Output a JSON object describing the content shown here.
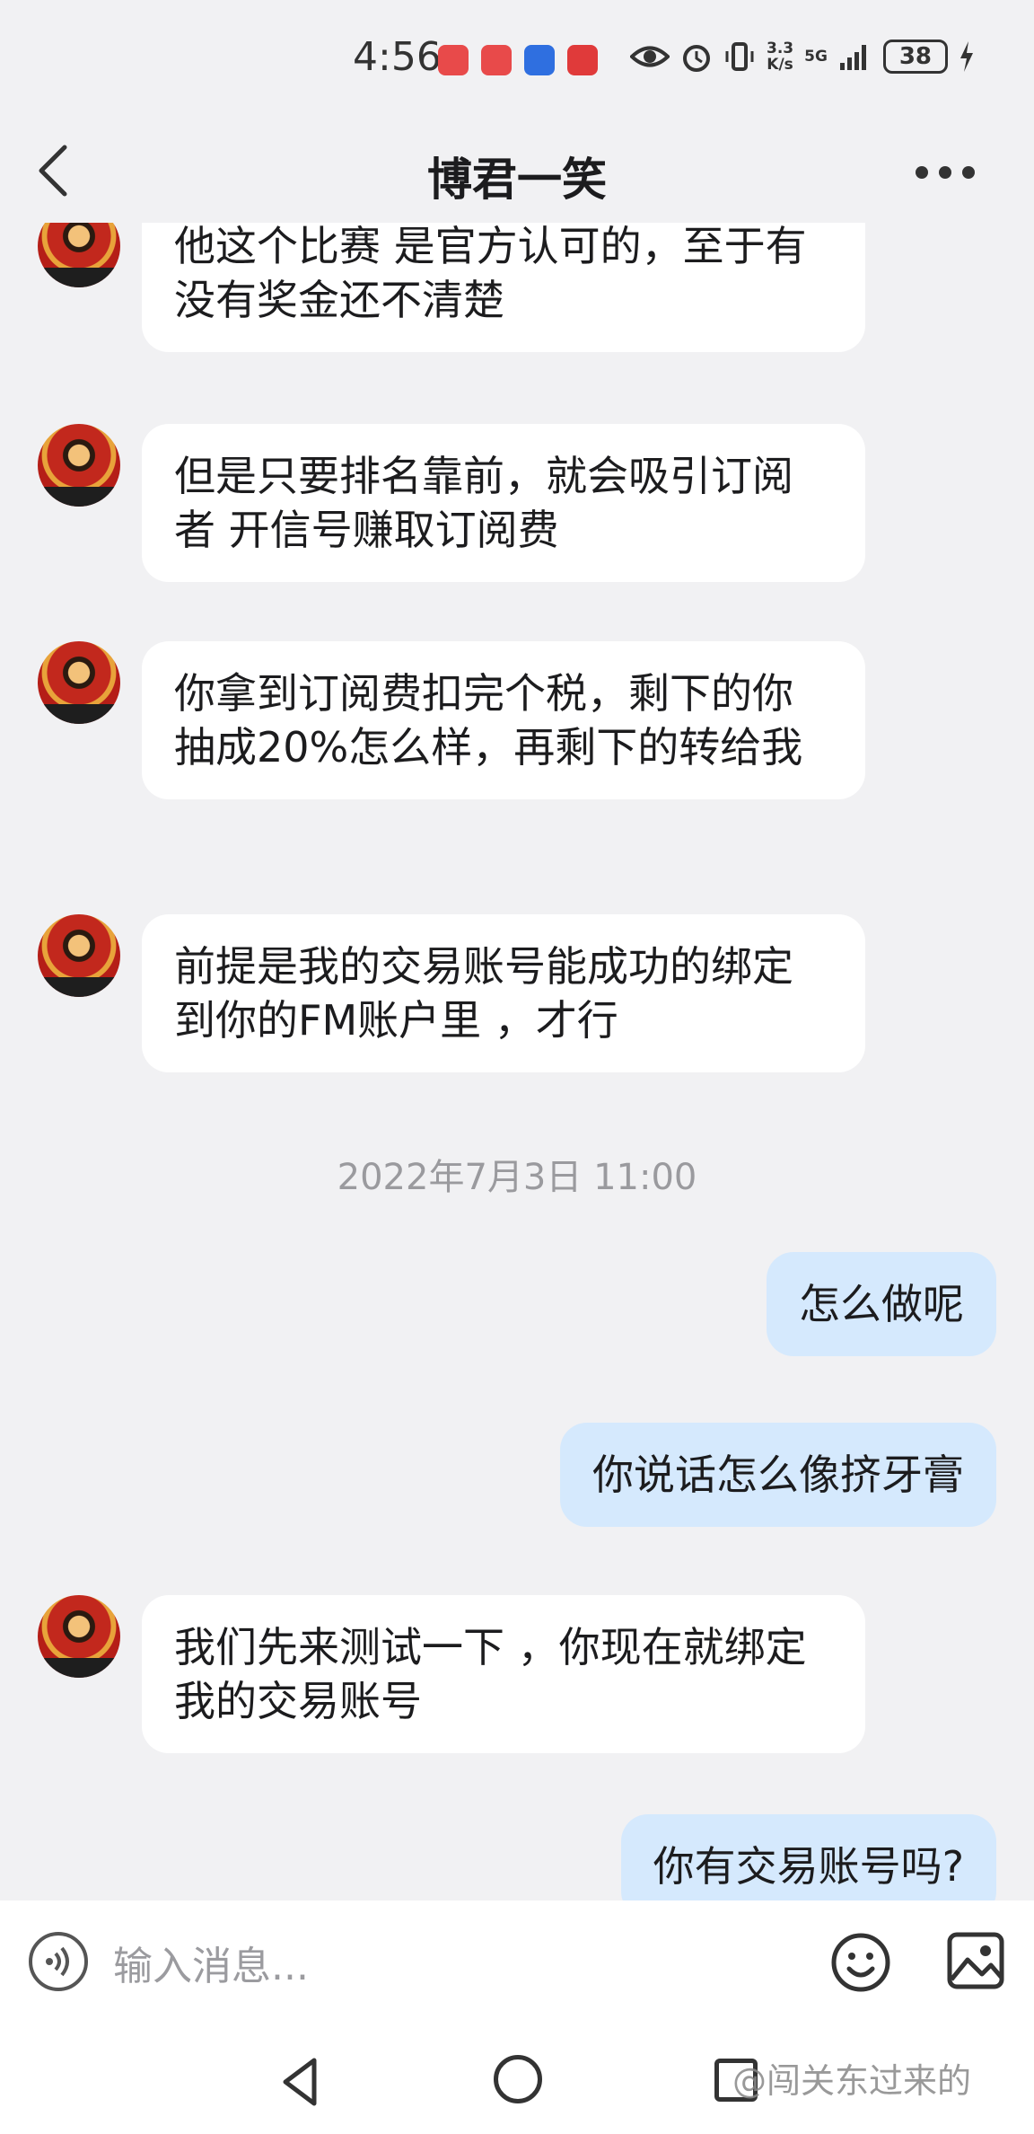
{
  "status_bar": {
    "time": "4:56",
    "net_speed_value": "3.3",
    "net_speed_unit": "K/s",
    "network": "5G",
    "battery": "38",
    "app_icon_colors": [
      "#e84a4a",
      "#e84a4a",
      "#2f6fe0",
      "#e03a3a"
    ]
  },
  "header": {
    "title": "博君一笑",
    "back_icon": "chevron-left-icon",
    "more_icon": "more-dots-icon"
  },
  "messages": [
    {
      "direction": "in",
      "text": "他这个比赛 是官方认可的，至于有没有奖金还不清楚"
    },
    {
      "direction": "in",
      "text": "但是只要排名靠前，就会吸引订阅者 开信号赚取订阅费"
    },
    {
      "direction": "in",
      "text": "你拿到订阅费扣完个税，剩下的你抽成20%怎么样，再剩下的转给我"
    },
    {
      "direction": "in",
      "text": "前提是我的交易账号能成功的绑定到你的FM账户里 ，才行"
    },
    {
      "direction": "time",
      "text": "2022年7月3日 11:00"
    },
    {
      "direction": "out",
      "text": "怎么做呢"
    },
    {
      "direction": "out",
      "text": "你说话怎么像挤牙膏"
    },
    {
      "direction": "in",
      "text": "我们先来测试一下 ，你现在就绑定我的交易账号"
    },
    {
      "direction": "out",
      "text": "你有交易账号吗?"
    }
  ],
  "input_bar": {
    "placeholder": "输入消息...",
    "voice_icon": "voice-icon",
    "emoji_icon": "emoji-icon",
    "image_icon": "image-icon"
  },
  "nav_bar": {
    "watermark": "@闯关东过来的"
  },
  "colors": {
    "background": "#f1f1f3",
    "incoming_bubble": "#ffffff",
    "outgoing_bubble": "#d5e9fd",
    "timestamp": "#9a9a9e"
  }
}
